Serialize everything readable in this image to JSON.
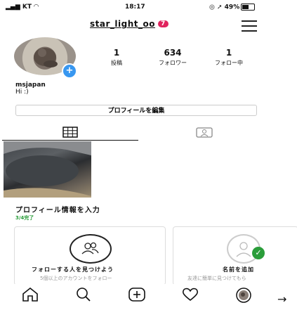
{
  "status_bar": {
    "carrier": "KT",
    "time": "18:17",
    "battery": "49%"
  },
  "header": {
    "username": "star_light_oo",
    "notification_count": "7"
  },
  "profile": {
    "stats": [
      {
        "value": "1",
        "label": "投稿"
      },
      {
        "value": "634",
        "label": "フォロワー"
      },
      {
        "value": "1",
        "label": "フォロー中"
      }
    ],
    "name": "msjapan",
    "bio": "Hi :)",
    "edit_button": "プロフィールを編集"
  },
  "tabs": [
    {
      "icon": "grid-icon"
    },
    {
      "icon": "tagged-icon"
    }
  ],
  "onboarding": {
    "title": "プロフィール情報を入力",
    "progress": "3/4完了",
    "cards": [
      {
        "title": "フォローする人を見つけよう",
        "subtitle": "5個以上のアカウントをフォロー",
        "icon": "people-icon"
      },
      {
        "title": "名前を追加",
        "subtitle": "友達に簡単に見つけてもら",
        "icon": "user-check-icon"
      }
    ]
  },
  "bottom_nav": [
    {
      "icon": "home-icon"
    },
    {
      "icon": "search-icon"
    },
    {
      "icon": "add-post-icon"
    },
    {
      "icon": "heart-icon"
    },
    {
      "icon": "profile-avatar-icon"
    }
  ],
  "colors": {
    "badge": "#e0245e",
    "accent": "#3897f0",
    "check": "#2a9d3a"
  }
}
